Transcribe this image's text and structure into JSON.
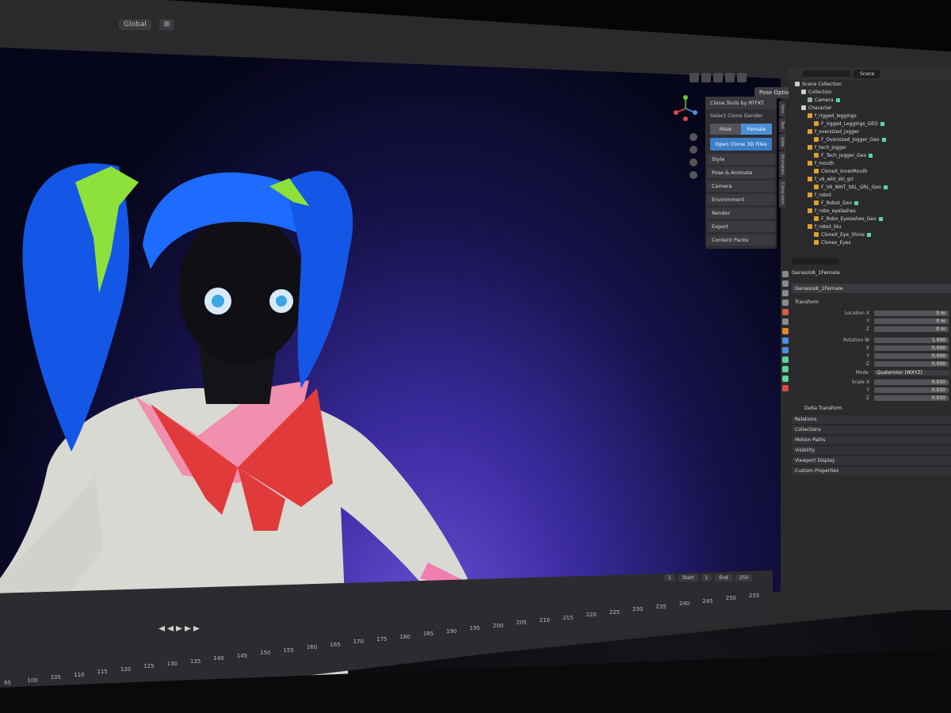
{
  "topbar": {
    "view_layer": "Global",
    "snap": "⊞"
  },
  "viewport": {
    "pose_options": "Pose Options"
  },
  "npanel": {
    "title": "Clone.Tools by RTFKT",
    "select_gender": "Select Clone Gender",
    "gender_male": "Male",
    "gender_female": "Female",
    "open_button": "Open Clone 3D Files",
    "sections": [
      "Style",
      "Pose & Animate",
      "Camera",
      "Environment",
      "Render",
      "Export",
      "Content Packs"
    ],
    "tabs": [
      "Item",
      "Tool",
      "View",
      "Animation",
      "Clone.tools"
    ]
  },
  "outliner": {
    "scene": "Scene",
    "rows": [
      "Scene Collection",
      "Collection",
      "Camera",
      "Character",
      "f_rigged_leggings",
      "F_rigged_Leggings_GEO",
      "f_oversized_jogger",
      "F_Oversized_Jogger_Geo",
      "f_tech_jogger",
      "F_Tech_Jogger_Geo",
      "f_mouth",
      "CloneX_InnerMouth",
      "f_v6_wht_skl_grl",
      "F_V6_WHT_SKL_GRL_Geo",
      "f_robot",
      "F_Robot_Geo",
      "f_robo_eyelashes",
      "F_Robo_Eyelashes_Geo",
      "f_robot_blu",
      "CloneX_Eye_Shine",
      "Clonex_Eyes"
    ]
  },
  "properties": {
    "object": "Genesis8_1Female",
    "data": "Genesis8_1Female",
    "transform": "Transform",
    "location_x_label": "Location X",
    "y": "Y",
    "z": "Z",
    "location": [
      "0 m",
      "0 m",
      "0 m"
    ],
    "rotation_w_label": "Rotation W",
    "x": "X",
    "rotation": [
      "1.000",
      "0.000",
      "0.000",
      "0.000"
    ],
    "mode_label": "Mode",
    "mode": "Quaternion (WXYZ)",
    "scale_x_label": "Scale X",
    "scale": [
      "0.010",
      "0.010",
      "0.010"
    ],
    "delta": "Delta Transform",
    "collapsed": [
      "Relations",
      "Collections",
      "Motion Paths",
      "Visibility",
      "Viewport Display",
      "Custom Properties"
    ]
  },
  "timeline": {
    "current": "1",
    "start_label": "Start",
    "start": "1",
    "end_label": "End",
    "end": "250",
    "frames": [
      "95",
      "100",
      "105",
      "110",
      "115",
      "120",
      "125",
      "130",
      "135",
      "140",
      "145",
      "150",
      "155",
      "160",
      "165",
      "170",
      "175",
      "180",
      "185",
      "190",
      "195",
      "200",
      "205",
      "210",
      "215",
      "220",
      "225",
      "230",
      "235",
      "240",
      "245",
      "250",
      "255"
    ]
  },
  "colors": {
    "accent": "#4d8fd6",
    "viewport_floor": "#6a4fd6",
    "hair": "#1e6bff"
  }
}
